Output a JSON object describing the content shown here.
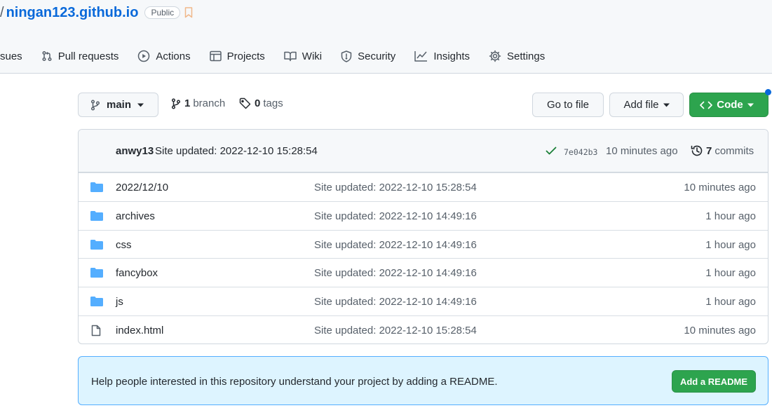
{
  "repo": {
    "separator": "/",
    "name": "ningan123.github.io",
    "visibility": "Public"
  },
  "tabs": [
    {
      "label": "sues",
      "icon": "issues-icon"
    },
    {
      "label": "Pull requests",
      "icon": "pull-request-icon"
    },
    {
      "label": "Actions",
      "icon": "play-icon"
    },
    {
      "label": "Projects",
      "icon": "table-icon"
    },
    {
      "label": "Wiki",
      "icon": "book-icon"
    },
    {
      "label": "Security",
      "icon": "shield-icon"
    },
    {
      "label": "Insights",
      "icon": "graph-icon"
    },
    {
      "label": "Settings",
      "icon": "gear-icon"
    }
  ],
  "toolbar": {
    "branch": "main",
    "branch_count": "1",
    "branch_label": "branch",
    "tag_count": "0",
    "tag_label": "tags",
    "go_to_file": "Go to file",
    "add_file": "Add file",
    "code": "Code"
  },
  "commit": {
    "author": "anwy13",
    "message": "Site updated: 2022-12-10 15:28:54",
    "sha": "7e042b3",
    "time": "10 minutes ago",
    "count": "7",
    "count_label": "commits"
  },
  "files": [
    {
      "name": "2022/12/10",
      "type": "folder",
      "message": "Site updated: 2022-12-10 15:28:54",
      "age": "10 minutes ago"
    },
    {
      "name": "archives",
      "type": "folder",
      "message": "Site updated: 2022-12-10 14:49:16",
      "age": "1 hour ago"
    },
    {
      "name": "css",
      "type": "folder",
      "message": "Site updated: 2022-12-10 14:49:16",
      "age": "1 hour ago"
    },
    {
      "name": "fancybox",
      "type": "folder",
      "message": "Site updated: 2022-12-10 14:49:16",
      "age": "1 hour ago"
    },
    {
      "name": "js",
      "type": "folder",
      "message": "Site updated: 2022-12-10 14:49:16",
      "age": "1 hour ago"
    },
    {
      "name": "index.html",
      "type": "file",
      "message": "Site updated: 2022-12-10 15:28:54",
      "age": "10 minutes ago"
    }
  ],
  "readme_banner": {
    "text": "Help people interested in this repository understand your project by adding a README.",
    "button": "Add a README"
  },
  "colors": {
    "link": "#0969da",
    "primary_button": "#2da44e",
    "folder": "#54aeff",
    "banner_bg": "#ddf4ff",
    "success_check": "#1a7f37"
  }
}
